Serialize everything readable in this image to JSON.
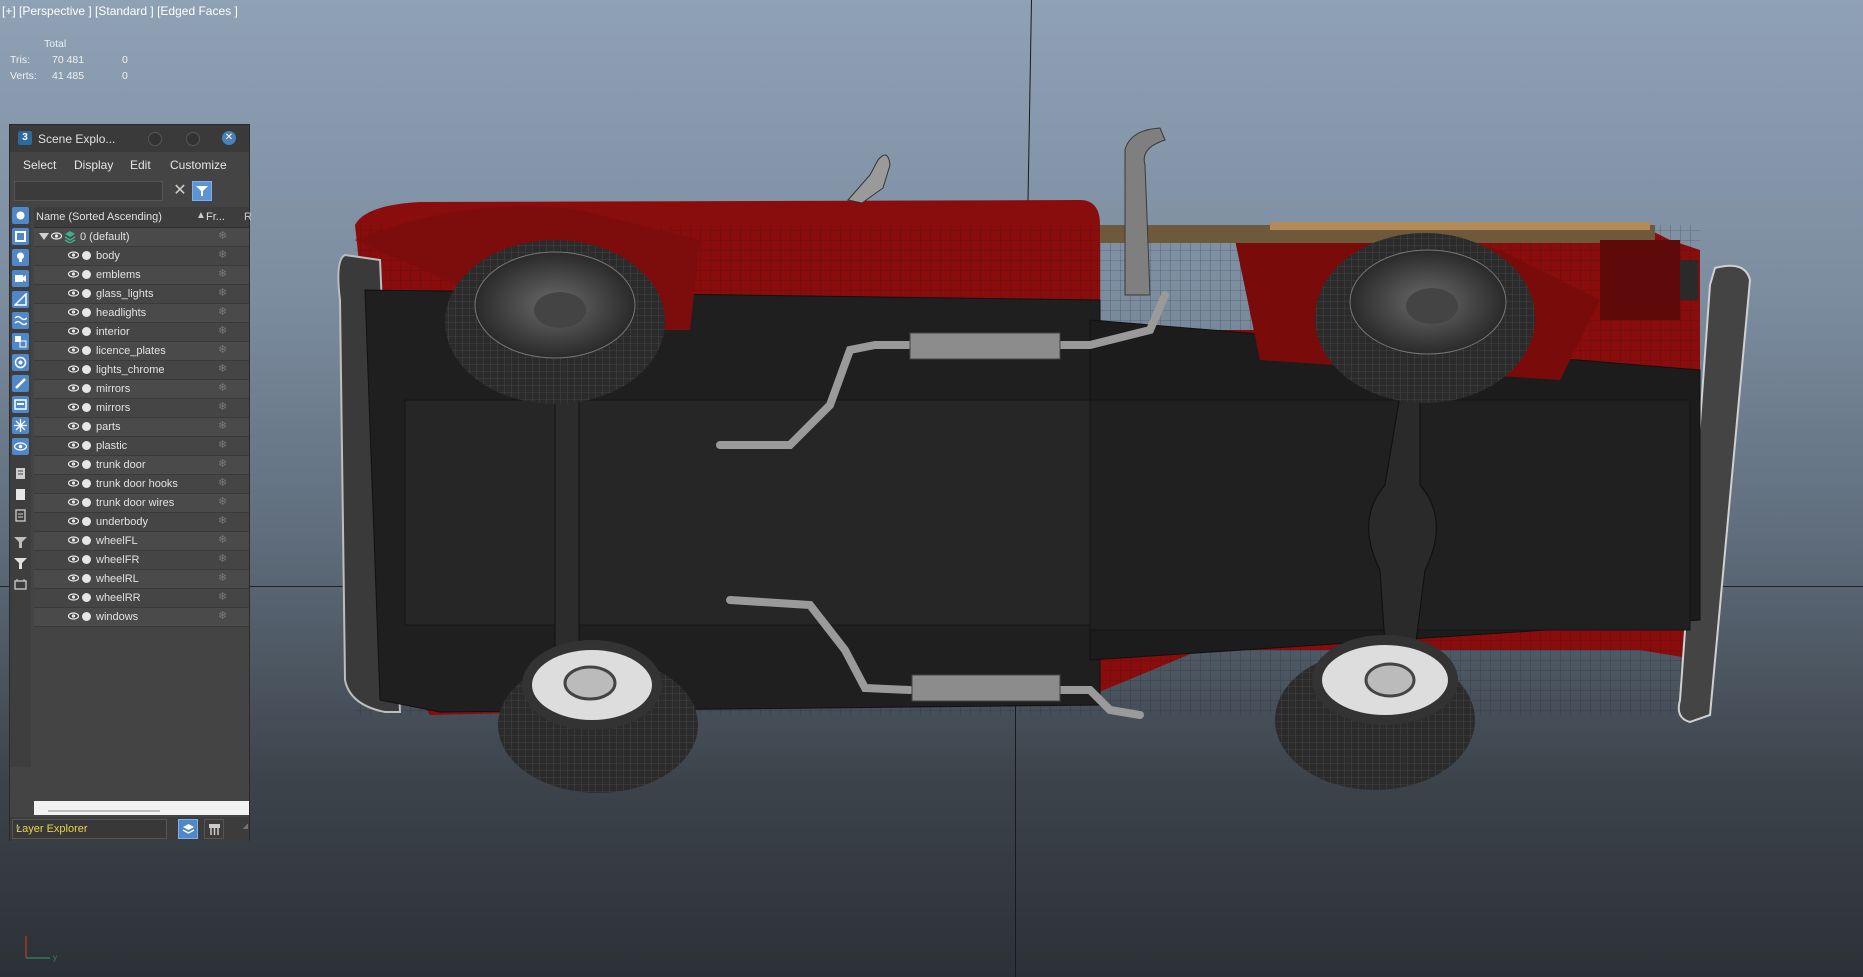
{
  "viewport": {
    "label": "[+] [Perspective ] [Standard ] [Edged Faces ]",
    "stats": {
      "header": "Total",
      "rows": [
        {
          "label": "Tris:",
          "total": "70 481",
          "selected": "0"
        },
        {
          "label": "Verts:",
          "total": "41 485",
          "selected": "0"
        }
      ]
    }
  },
  "scene_explorer": {
    "app_icon": "3",
    "title": "Scene Explo...",
    "menu": [
      "Select",
      "Display",
      "Edit",
      "Customize"
    ],
    "search": {
      "value": "",
      "placeholder": ""
    },
    "columns": {
      "name": "Name (Sorted Ascending)",
      "frozen": "Fr...",
      "render": "R"
    },
    "root_layer": "0 (default)",
    "items": [
      "body",
      "emblems",
      "glass_lights",
      "headlights",
      "interior",
      "licence_plates",
      "lights_chrome",
      "mirrors",
      "mirrors",
      "parts",
      "plastic",
      "trunk door",
      "trunk door hooks",
      "trunk door wires",
      "underbody",
      "wheelFL",
      "wheelFR",
      "wheelRL",
      "wheelRR",
      "windows"
    ],
    "footer_mode": "Layer Explorer"
  },
  "icons": {
    "toolstrip": [
      "display-all-icon",
      "geometry-icon",
      "shapes-icon",
      "lights-icon",
      "cameras-icon",
      "helpers-icon",
      "spacewarps-icon",
      "groups-icon",
      "xrefs-icon",
      "bones-icon",
      "containers-icon",
      "frozen-icon",
      "hidden-icon",
      "display-none-icon",
      "display-all-icon-2",
      "invert-icon",
      "filter-icon",
      "filter-funnel-icon",
      "selection-set-icon"
    ]
  },
  "colors": {
    "accent": "#4f87c7",
    "layer_explorer_text": "#e8d34a",
    "truck_red": "#8a0d0d"
  }
}
